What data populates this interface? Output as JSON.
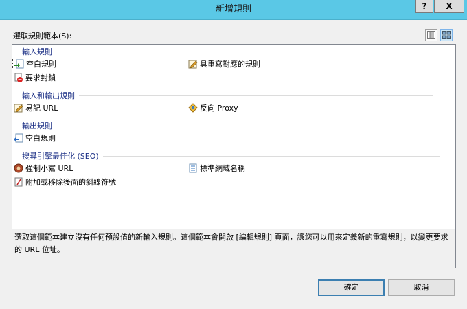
{
  "window": {
    "title": "新增規則",
    "help_label": "?",
    "close_label": "X"
  },
  "select_label": "選取規則範本(S):",
  "view_icons": [
    "details-view-icon",
    "large-icons-view-icon"
  ],
  "groups": [
    {
      "label": "輸入規則",
      "items": [
        {
          "label": "空白規則",
          "icon": "blank-inbound-rule-icon",
          "selected": true
        },
        {
          "label": "具重寫對應的規則",
          "icon": "rewrite-map-rule-icon"
        },
        {
          "label": "要求封鎖",
          "icon": "request-blocking-icon"
        }
      ]
    },
    {
      "label": "輸入和輸出規則",
      "items": [
        {
          "label": "易記 URL",
          "icon": "user-friendly-url-icon"
        },
        {
          "label": "反向 Proxy",
          "icon": "reverse-proxy-icon"
        }
      ]
    },
    {
      "label": "輸出規則",
      "items": [
        {
          "label": "空白規則",
          "icon": "blank-outbound-rule-icon"
        }
      ]
    },
    {
      "label": "搜尋引擎最佳化 (SEO)",
      "items": [
        {
          "label": "強制小寫 URL",
          "icon": "lowercase-url-icon"
        },
        {
          "label": "標準網域名稱",
          "icon": "canonical-domain-icon"
        },
        {
          "label": "附加或移除後面的斜線符號",
          "icon": "trailing-slash-icon"
        }
      ]
    }
  ],
  "description": "選取這個範本建立沒有任何預設值的新輸入規則。這個範本會開啟 [編輯規則] 頁面，讓您可以用來定義新的重寫規則，以變更要求的 URL 位址。",
  "buttons": {
    "ok": "確定",
    "cancel": "取消"
  }
}
